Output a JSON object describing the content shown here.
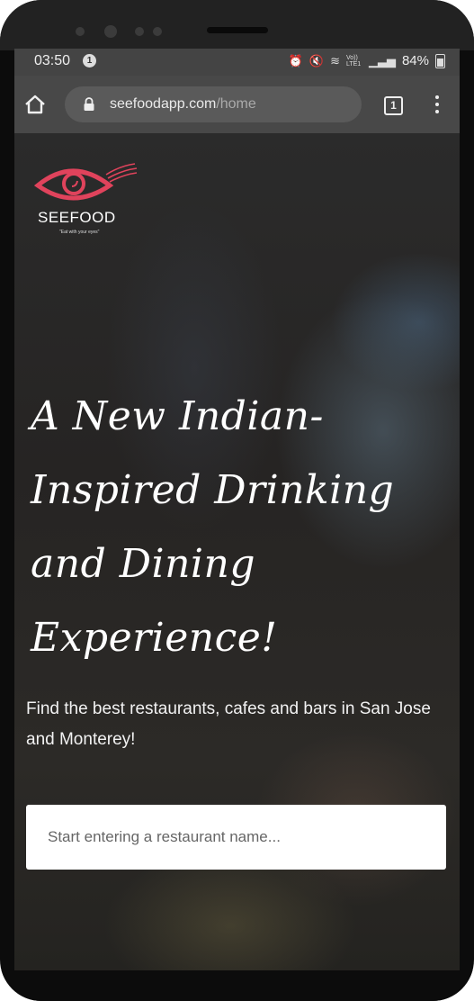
{
  "status_bar": {
    "time": "03:50",
    "notification_count": "1",
    "network_label": "Vo)) LTE1",
    "battery": "84%"
  },
  "browser": {
    "url_host": "seefoodapp.com",
    "url_path": "/home",
    "tab_count": "1"
  },
  "brand": {
    "name": "SEEFOOD",
    "tagline": "\"Eat with your eyes\"",
    "accent_color": "#e0435c"
  },
  "hero": {
    "headline": "A New Indian-Inspired Drinking and Dining Experience!",
    "subtext": "Find the best restaurants, cafes and bars in San Jose and Monterey!"
  },
  "search": {
    "placeholder": "Start entering a restaurant name...",
    "value": ""
  }
}
